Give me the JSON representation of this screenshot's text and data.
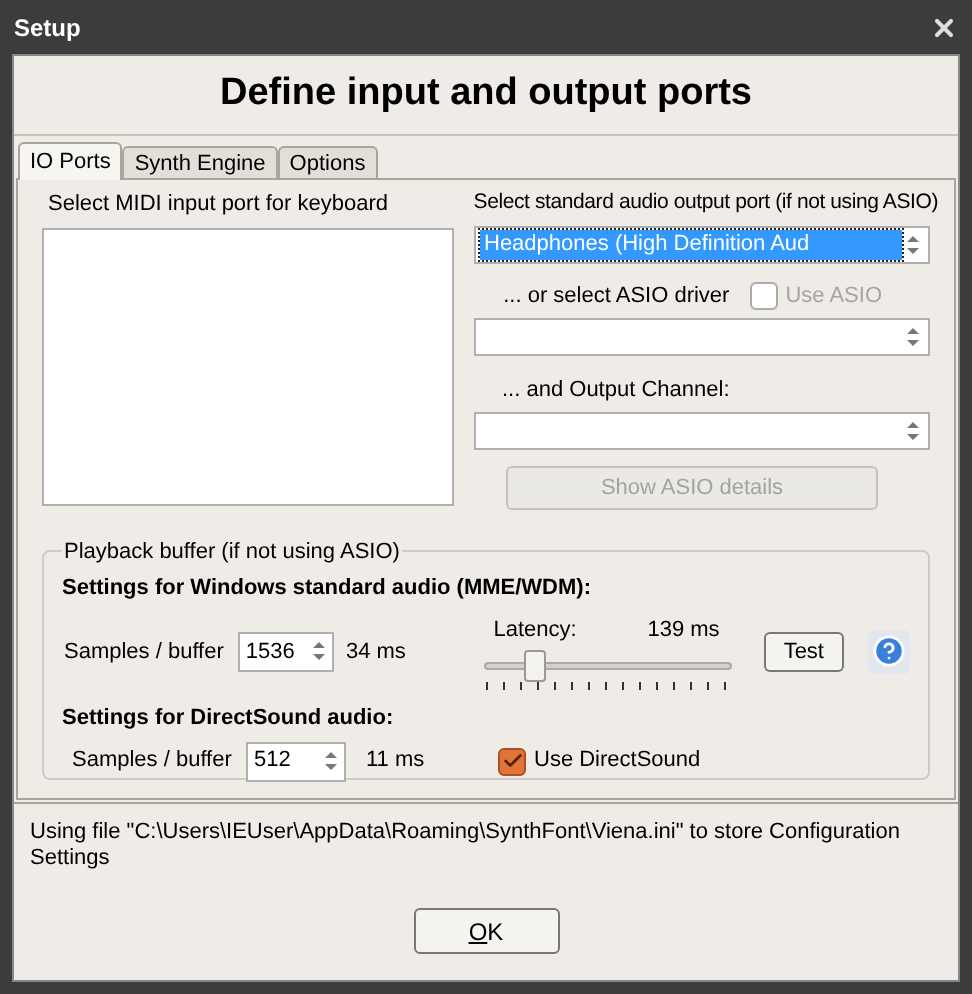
{
  "window": {
    "title": "Setup"
  },
  "heading": "Define input and output ports",
  "tabs": [
    {
      "label": "IO Ports",
      "selected": true
    },
    {
      "label": "Synth Engine",
      "selected": false
    },
    {
      "label": "Options",
      "selected": false
    }
  ],
  "midi_input": {
    "label": "Select MIDI input port for keyboard"
  },
  "audio_output": {
    "label": "Select standard audio output port (if not using ASIO)",
    "value": "Headphones (High Definition Aud"
  },
  "asio": {
    "label": "... or select ASIO driver",
    "use_asio": {
      "label": "Use ASIO",
      "checked": false,
      "disabled": true
    },
    "channel_label": "... and Output Channel:",
    "details_button": {
      "label": "Show ASIO details",
      "disabled": true
    }
  },
  "playback_buffer": {
    "legend": "Playback buffer (if not using ASIO)",
    "mme": {
      "title": "Settings for Windows standard audio (MME/WDM):",
      "samples_label": "Samples / buffer",
      "samples": "1536",
      "ms": "34 ms",
      "latency_label": "Latency:",
      "latency_value": "139 ms",
      "level": 0.2,
      "test_button": "Test"
    },
    "directsound": {
      "title": "Settings for DirectSound audio:",
      "samples_label": "Samples / buffer",
      "samples": "512",
      "ms": "11 ms",
      "use_directsound": {
        "label": "Use DirectSound",
        "checked": true
      }
    }
  },
  "status": "Using file \"C:\\Users\\IEUser\\AppData\\Roaming\\SynthFont\\Viena.ini\" to store Configuration Settings",
  "ok_button": "OK"
}
